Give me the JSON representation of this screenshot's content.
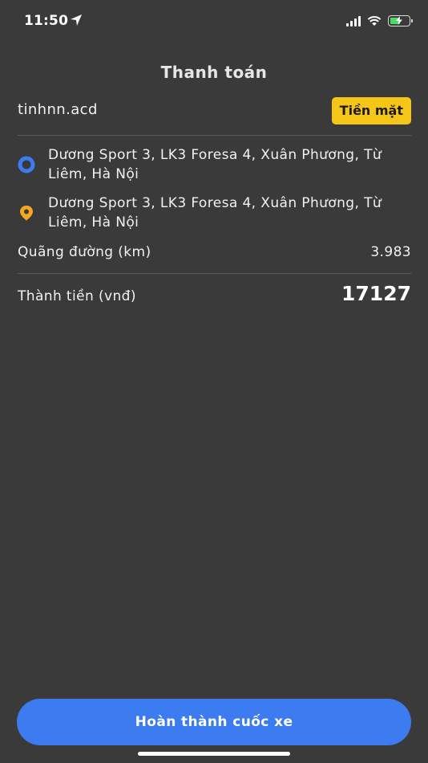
{
  "status_bar": {
    "time": "11:50",
    "icons": [
      "location-arrow-icon",
      "cellular-signal-icon",
      "wifi-icon",
      "battery-charging-icon"
    ],
    "battery_color": "#4cd964"
  },
  "header": {
    "title": "Thanh toán"
  },
  "user": {
    "username": "tinhnn.acd",
    "payment_method": "Tiền mặt",
    "payment_badge_color": "#f5c518"
  },
  "route": {
    "pickup": {
      "address": "Dương Sport 3, LK3 Foresa 4, Xuân Phương, Từ Liêm, Hà Nội",
      "icon": "pickup-marker-icon",
      "color": "#3d7bf0"
    },
    "dropoff": {
      "address": "Dương Sport 3, LK3 Foresa 4, Xuân Phương, Từ Liêm, Hà Nội",
      "icon": "dropoff-marker-icon",
      "color": "#f5a623"
    }
  },
  "distance": {
    "label": "Quãng đường (km)",
    "value": "3.983"
  },
  "total": {
    "label": "Thành tiền (vnđ)",
    "value": "17127"
  },
  "actions": {
    "complete_label": "Hoàn thành cuốc xe",
    "complete_color": "#3d7bf0"
  }
}
